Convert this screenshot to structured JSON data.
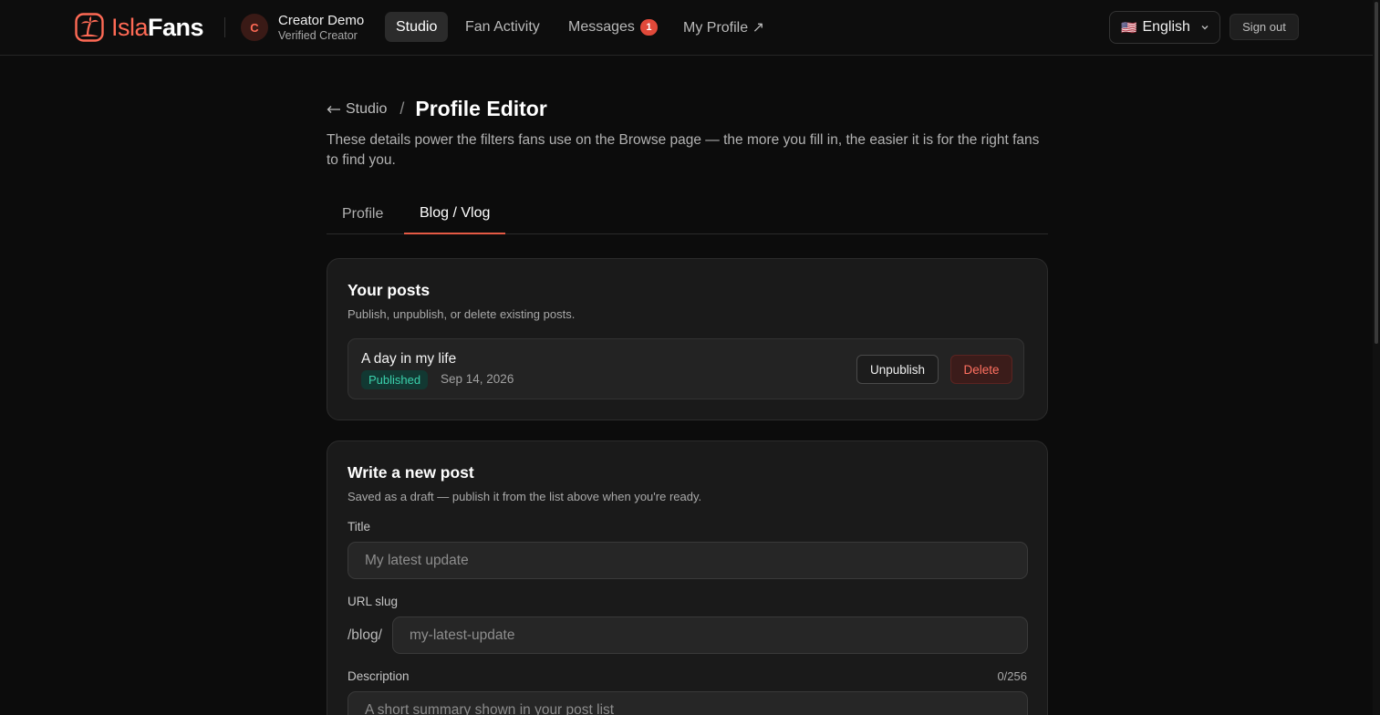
{
  "header": {
    "logo": {
      "part1": "Isla",
      "part2": "Fans"
    },
    "user": {
      "initial": "C",
      "name": "Creator Demo",
      "role": "Verified Creator"
    },
    "nav": [
      {
        "label": "Studio",
        "active": true
      },
      {
        "label": "Fan Activity",
        "active": false
      },
      {
        "label": "Messages",
        "badge": "1",
        "active": false
      },
      {
        "label": "My Profile ↗",
        "active": false
      }
    ],
    "language": {
      "flag": "🇺🇸",
      "label": "English"
    },
    "signout_label": "Sign out"
  },
  "breadcrumb": {
    "back_label": "Studio",
    "separator": "/",
    "title": "Profile Editor"
  },
  "page_description": "These details power the filters fans use on the Browse page — the more you fill in, the easier it is for the right fans to find you.",
  "tabs": [
    {
      "label": "Profile",
      "active": false
    },
    {
      "label": "Blog / Vlog",
      "active": true
    }
  ],
  "posts_card": {
    "title": "Your posts",
    "subtitle": "Publish, unpublish, or delete existing posts.",
    "posts": [
      {
        "title": "A day in my life",
        "status": "Published",
        "date": "Sep 14, 2026",
        "unpublish_label": "Unpublish",
        "delete_label": "Delete"
      }
    ]
  },
  "new_post_card": {
    "title": "Write a new post",
    "subtitle": "Saved as a draft — publish it from the list above when you're ready.",
    "title_field": {
      "label": "Title",
      "placeholder": "My latest update",
      "value": ""
    },
    "slug_field": {
      "label": "URL slug",
      "prefix": "/blog/",
      "placeholder": "my-latest-update",
      "value": ""
    },
    "description_field": {
      "label": "Description",
      "counter": "0/256",
      "placeholder": "A short summary shown in your post list",
      "value": ""
    }
  },
  "colors": {
    "accent": "#e55a45",
    "background": "#0c0c0c",
    "card": "#1a1a1a",
    "published_green": "#3ad1ac",
    "danger": "#ff7060"
  }
}
